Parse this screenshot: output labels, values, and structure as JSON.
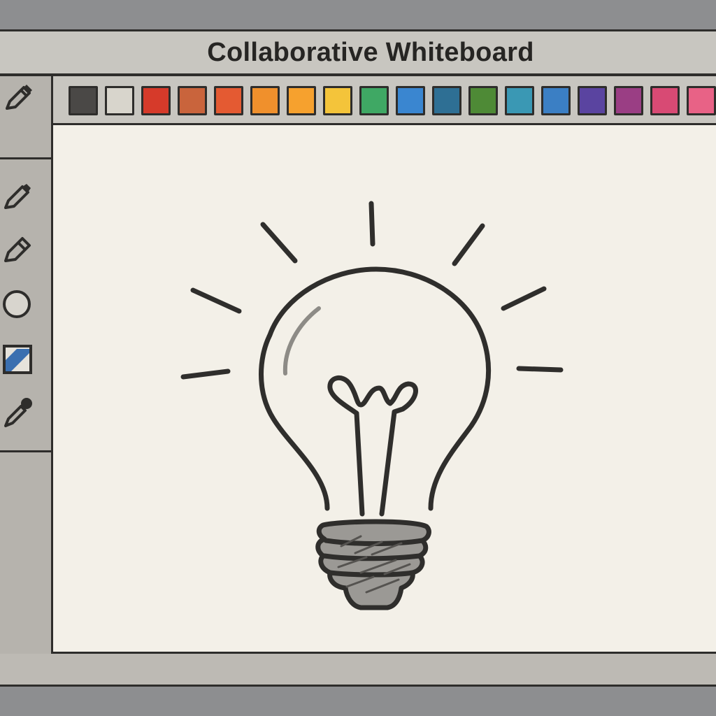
{
  "app": {
    "title": "Collaborative Whiteboard"
  },
  "toolbar": {
    "tools": [
      {
        "name": "pen",
        "icon": "pen-icon"
      },
      {
        "name": "pencil",
        "icon": "pencil-icon"
      },
      {
        "name": "marker",
        "icon": "marker-icon"
      },
      {
        "name": "circle",
        "icon": "circle-icon"
      },
      {
        "name": "fill",
        "icon": "fill-icon"
      },
      {
        "name": "eyedropper",
        "icon": "eyedropper-icon"
      }
    ]
  },
  "palette": {
    "colors": [
      "#4a4846",
      "#d8d5cc",
      "#d63a2a",
      "#c9643c",
      "#e45a32",
      "#f0902c",
      "#f6a12e",
      "#f4c43a",
      "#3fa864",
      "#3a86d0",
      "#2e6f94",
      "#4e8a36",
      "#3a98b4",
      "#3b7fc4",
      "#5a44a0",
      "#9a3e84",
      "#d84a74",
      "#e86286",
      "#3aa070"
    ]
  },
  "canvas": {
    "drawing": "lightbulb-sketch",
    "stroke_color": "#2f2e2c"
  }
}
